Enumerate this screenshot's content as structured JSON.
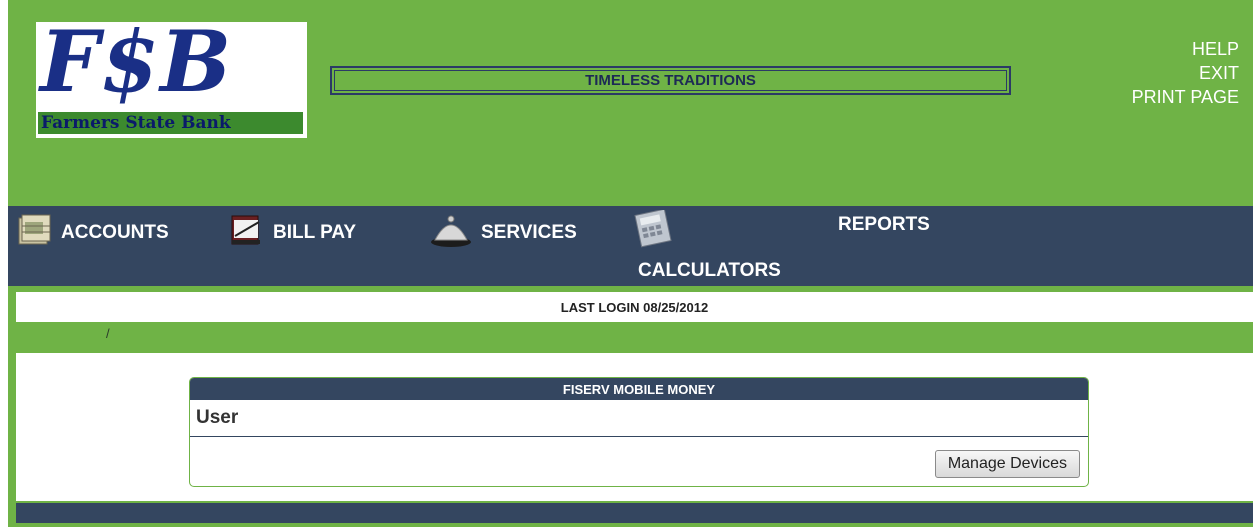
{
  "logo": {
    "letters": "F$B",
    "bank_name": "Farmers State Bank"
  },
  "tagline": "TIMELESS TRADITIONS",
  "top_links": [
    "HELP",
    "EXIT",
    "PRINT PAGE"
  ],
  "nav": {
    "accounts": "ACCOUNTS",
    "bill_pay": "BILL PAY",
    "services": "SERVICES",
    "calculators": "CALCULATORS",
    "reports": "REPORTS"
  },
  "last_login": "LAST LOGIN 08/25/2012",
  "breadcrumb": "/",
  "panel": {
    "title": "FISERV MOBILE MONEY",
    "user_label": "User",
    "manage_button": "Manage Devices"
  },
  "colors": {
    "page_green": "#6fb346",
    "nav_navy": "#344660",
    "logo_blue": "#1a2f86"
  }
}
